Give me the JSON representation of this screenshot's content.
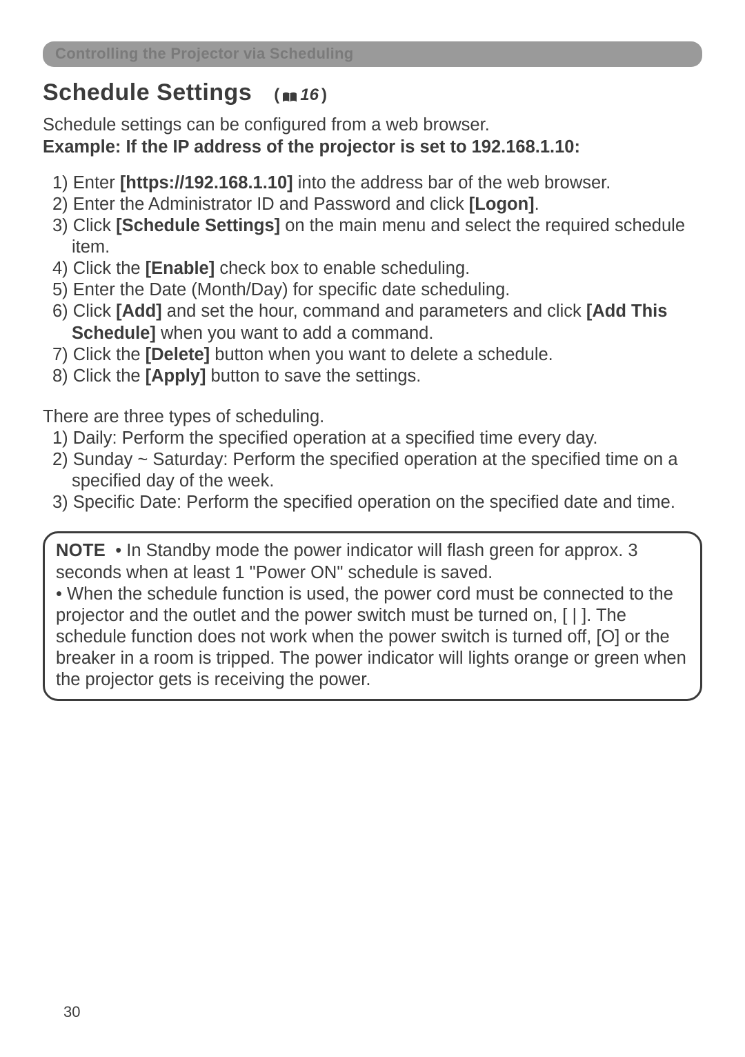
{
  "banner": "Controlling the Projector via Scheduling",
  "heading": "Schedule Settings",
  "ref": {
    "open": "(",
    "num": "16",
    "close": ")"
  },
  "intro_line1": "Schedule settings can be configured from a web browser.",
  "intro_bold": "Example: If the IP address of the projector is set to 192.168.1.10:",
  "steps": [
    {
      "n": "1)",
      "pre": " Enter ",
      "b1": "[https://192.168.1.10]",
      "post": " into the address bar of the web browser."
    },
    {
      "n": "2)",
      "pre": " Enter the Administrator ID and Password and click ",
      "b1": "[Logon]",
      "post": "."
    },
    {
      "n": "3)",
      "pre": " Click ",
      "b1": "[Schedule Settings]",
      "post": " on the main menu and select the required schedule item."
    },
    {
      "n": "4)",
      "pre": " Click the ",
      "b1": "[Enable]",
      "post": " check box to enable scheduling."
    },
    {
      "n": "5)",
      "pre": " Enter the Date (Month/Day) for specific date scheduling.",
      "b1": "",
      "post": ""
    },
    {
      "n": "6)",
      "pre": " Click ",
      "b1": "[Add]",
      "mid": " and set the hour, command and parameters and click ",
      "b2": "[Add This Schedule]",
      "post": " when you want to add a command."
    },
    {
      "n": "7)",
      "pre": " Click the ",
      "b1": "[Delete]",
      "post": " button when you want to delete a schedule."
    },
    {
      "n": "8)",
      "pre": " Click the ",
      "b1": "[Apply]",
      "post": " button to save the settings."
    }
  ],
  "types_intro": "There are three types of scheduling.",
  "types": [
    {
      "n": "1)",
      "t": " Daily: Perform the specified operation at a specified time every day."
    },
    {
      "n": "2)",
      "t": " Sunday ~ Saturday: Perform the specified operation at the specified time on a specified day of the week."
    },
    {
      "n": "3)",
      "t": " Specific Date: Perform the specified operation on the specified date and time."
    }
  ],
  "note_label": "NOTE",
  "note_body": "  • In Standby mode the power indicator will flash green for approx. 3 seconds when at least 1 \"Power ON\" schedule is saved.\n• When the schedule function is used, the power cord must be connected to the projector and the outlet and the power switch must be turned on, [ | ]. The schedule function does not work when the power switch is turned off, [O] or the breaker in a room is tripped. The power indicator will lights orange or green when the projector gets is receiving the power.",
  "page_number": "30"
}
